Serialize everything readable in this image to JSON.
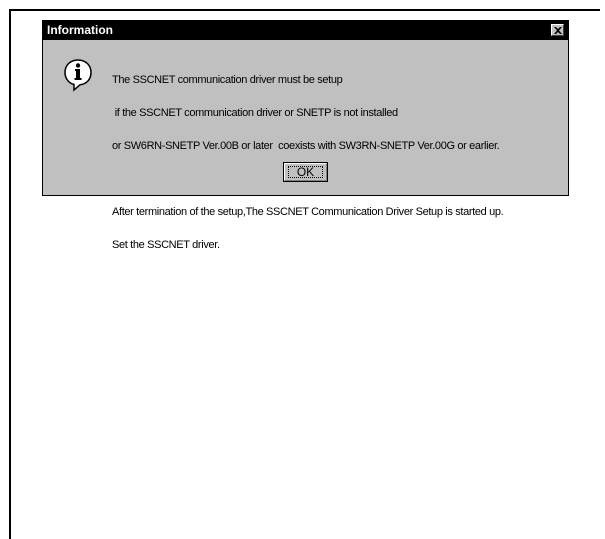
{
  "dialog": {
    "title": "Information",
    "close_icon": "close-x-icon",
    "icon": "information-icon",
    "message_lines": [
      "The SSCNET communication driver must be setup",
      " if the SSCNET communication driver or SNETP is not installed",
      "or SW6RN-SNETP Ver.00B or later  coexists with SW3RN-SNETP Ver.00G or earlier."
    ],
    "message_lines_2": [
      "After termination of the setup,The SSCNET Communication Driver Setup is started up.",
      "Set the SSCNET driver."
    ],
    "ok_label": "OK"
  },
  "colors": {
    "dialog_face": "#c0c0c0",
    "titlebar": "#000000",
    "title_text": "#ffffff",
    "frame_border": "#000000"
  }
}
